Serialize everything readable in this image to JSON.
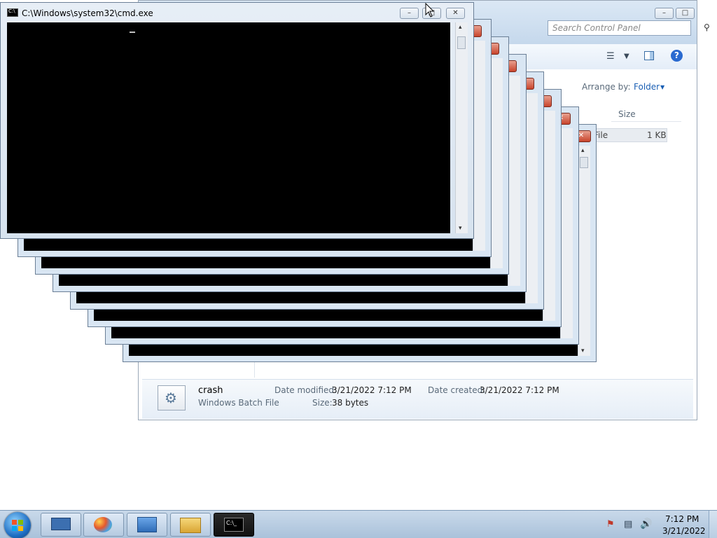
{
  "cmd": {
    "title": "C:\\Windows\\system32\\cmd.exe",
    "minimize_glyph": "–",
    "maximize_glyph": "□",
    "close_glyph": "✕",
    "scroll_up_glyph": "▴",
    "scroll_down_glyph": "▾",
    "cascade_close_glyph": "✕"
  },
  "explorer": {
    "search_placeholder": "Search Control Panel",
    "arrange_by_label": "Arrange by:",
    "arrange_by_value": "Folder",
    "column_size": "Size",
    "row_type_fragment": "File",
    "row_size": "1 KB",
    "help_glyph": "?"
  },
  "details": {
    "file_name": "crash",
    "file_type": "Windows Batch File",
    "date_modified_label": "Date modified:",
    "date_modified_value": "3/21/2022 7:12 PM",
    "date_created_label": "Date created:",
    "date_created_value": "3/21/2022 7:12 PM",
    "size_label": "Size:",
    "size_value": "38 bytes"
  },
  "taskbar": {
    "cmd_icon_text": "C:\\_",
    "clock_time": "7:12 PM",
    "clock_date": "3/21/2022"
  },
  "colors": {
    "window_frame": "#d9e6f3",
    "console_bg": "#000000",
    "close_red": "#c8442c",
    "link_blue": "#1a5fb4"
  }
}
